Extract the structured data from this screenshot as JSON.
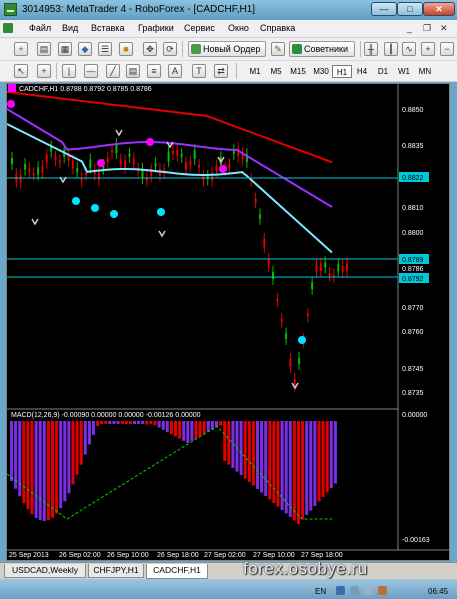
{
  "window": {
    "title": "3014953: MetaTrader 4 - RoboForex - [CADCHF,H1]",
    "min": "—",
    "max": "□",
    "close": "✕"
  },
  "menu": {
    "items": [
      "Файл",
      "Вид",
      "Вставка",
      "Графики",
      "Сервис",
      "Окно",
      "Справка"
    ]
  },
  "toolbar": {
    "new_order": "Новый Ордер",
    "advisors": "Советники",
    "timeframes": [
      "M1",
      "M5",
      "M15",
      "M30",
      "H1",
      "H4",
      "D1",
      "W1",
      "MN"
    ],
    "selected_timeframe": "H1",
    "text_tool": "A"
  },
  "chart": {
    "header": "CADCHF,H1  0.8788 0.8792 0.8785 0.8786",
    "macd_label": "MACD(12,26,9)  -0.00090 0.00000 0.00000 -0.00126 0.00000",
    "price_labels": [
      "0.8850",
      "0.8835",
      "0.8810",
      "0.8800",
      "0.8786",
      "0.8770",
      "0.8760",
      "0.8745",
      "0.8735"
    ],
    "highlight_labels": [
      {
        "text": "0.8822",
        "color": "#00c8d8"
      },
      {
        "text": "0.8789",
        "color": "#00c8d8"
      },
      {
        "text": "0.8792",
        "color": "#00c8d8"
      }
    ],
    "macd_scale": [
      "0.00000",
      "-0.00163"
    ],
    "time_labels": [
      "25 Sep 2013",
      "26 Sep 02:00",
      "26 Sep 10:00",
      "26 Sep 18:00",
      "27 Sep 02:00",
      "27 Sep 10:00",
      "27 Sep 18:00"
    ],
    "colors": {
      "background": "#000000",
      "bull_candle": "#00c000",
      "bear_candle": "#e00000",
      "ma_red": "#e00000",
      "ma_purple": "#9b30ff",
      "ma_cyan": "#7fe8ff",
      "dot_magenta": "#ff00ff",
      "dot_cyan": "#00e5ff",
      "macd_bar_red": "#e00000",
      "macd_bar_purple": "#7a2ee6",
      "signal_line": "#00d000"
    }
  },
  "tabs": [
    "USDCAD,Weekly",
    "CHFJPY,H1",
    "CADCHF,H1"
  ],
  "active_tab": "CADCHF,H1",
  "watermark": "forex.osobye.ru",
  "status": {
    "language": "EN",
    "clock": "06:45"
  }
}
